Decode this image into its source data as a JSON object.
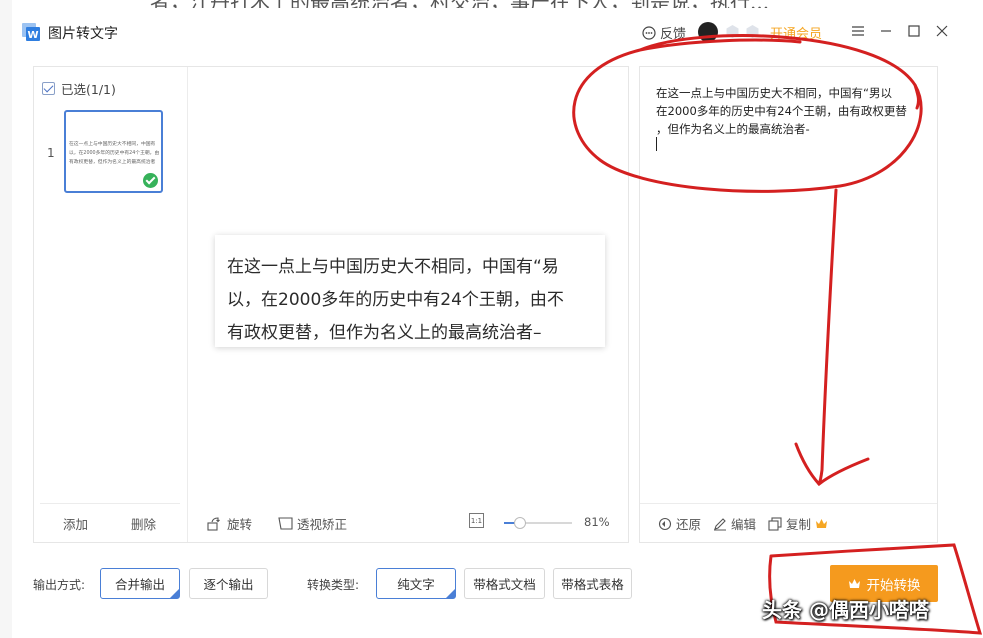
{
  "app": {
    "title": "图片转文字",
    "background_text": "者，江丹打术上的最高统治者，村交治，事产在下人，到是说，执行..."
  },
  "header": {
    "feedback_label": "反馈",
    "vip_label": "开通会员",
    "colors": {
      "vip": "#f5a623"
    }
  },
  "thumbs": {
    "select_all_label": "已选(1/1)",
    "items": [
      {
        "index": "1",
        "lines": [
          "在这一点上与中国历史大不相同，中国有",
          "以，在2000多年的历史中有24个王朝，由",
          "有政权更替，但作为名义上的最高统治者"
        ]
      }
    ],
    "add_label": "添加",
    "delete_label": "删除"
  },
  "preview": {
    "lines": [
      "在这一点上与中国历史大不相同，中国有“易",
      "以，在2000多年的历史中有24个王朝，由不",
      "有政权更替，但作为名义上的最高统治者–"
    ],
    "rotate_label": "旋转",
    "perspective_label": "透视矫正",
    "zoom_fit_label": "1:1",
    "zoom_value": "81%",
    "zoom_fraction": 0.23
  },
  "result": {
    "text": "在这一点上与中国历史大不相同，中国有“男以\n在2000多年的历史中有24个王朝，由有政权更替\n，但作为名义上的最高统治者-",
    "restore_label": "还原",
    "edit_label": "编辑",
    "copy_label": "复制"
  },
  "bottom": {
    "output_mode_label": "输出方式:",
    "output_modes": [
      "合并输出",
      "逐个输出"
    ],
    "convert_type_label": "转换类型:",
    "convert_types": [
      "纯文字",
      "带格式文档",
      "带格式表格"
    ],
    "start_label": "开始转换",
    "colors": {
      "primary": "#4a7fd6",
      "start": "#f59a1e"
    }
  },
  "watermark": "头条 @偶西小嗒嗒"
}
